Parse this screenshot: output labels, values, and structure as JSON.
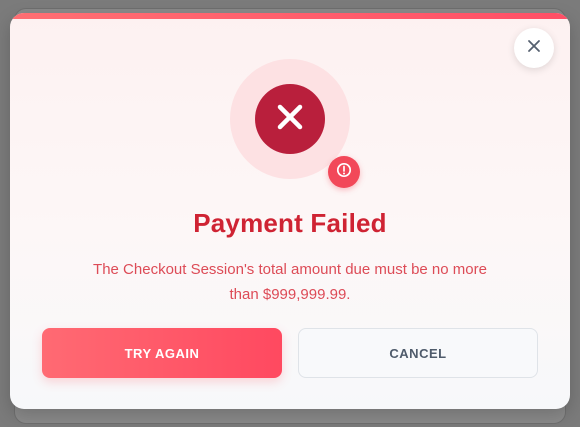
{
  "modal": {
    "title": "Payment Failed",
    "message": "The Checkout Session's total amount due must be no more than $999,999.99.",
    "primary_action": "TRY AGAIN",
    "secondary_action": "CANCEL",
    "icons": {
      "close": "close-icon",
      "status": "x-icon",
      "alert": "exclamation-circle-icon"
    },
    "colors": {
      "accent": "#ff4f66",
      "danger": "#b91f3c",
      "title": "#cf2333",
      "message": "#dd4b57"
    }
  }
}
